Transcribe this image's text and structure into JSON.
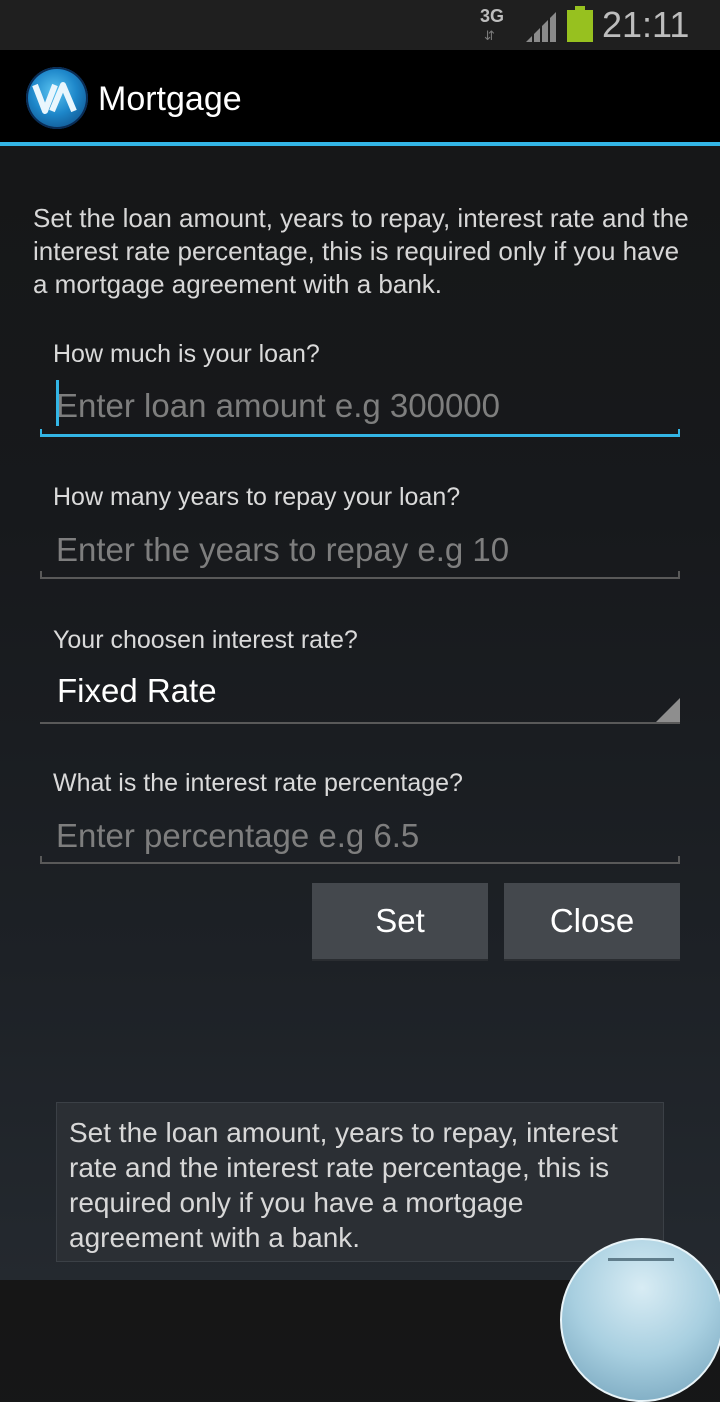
{
  "status_bar": {
    "network": "3G",
    "time": "21:11",
    "colors": {
      "battery": "#97c11f",
      "icons": "#bdbdbd"
    },
    "icons": [
      "data-arrows-icon",
      "signal-icon",
      "battery-icon"
    ]
  },
  "action_bar": {
    "title": "Mortgage",
    "logo_icon": "app-logo-icon",
    "accent_color": "#33b5e5"
  },
  "intro": "Set the loan amount, years to repay, interest rate and the interest rate percentage, this is required only if you have a mortgage agreement with a bank.",
  "form": {
    "loan": {
      "label": "How much is your loan?",
      "placeholder": "Enter loan amount e.g 300000",
      "value": ""
    },
    "years": {
      "label": "How many years to repay your loan?",
      "placeholder": "Enter the years to repay e.g 10",
      "value": ""
    },
    "rate_type": {
      "label": "Your choosen interest rate?",
      "selected": "Fixed Rate"
    },
    "percentage": {
      "label": "What is the interest rate percentage?",
      "placeholder": "Enter percentage e.g 6.5",
      "value": ""
    }
  },
  "buttons": {
    "set": "Set",
    "close": "Close"
  },
  "toast": "Set the loan amount, years to repay, interest rate and the interest rate percentage, this is required only if you have a mortgage agreement with a bank."
}
